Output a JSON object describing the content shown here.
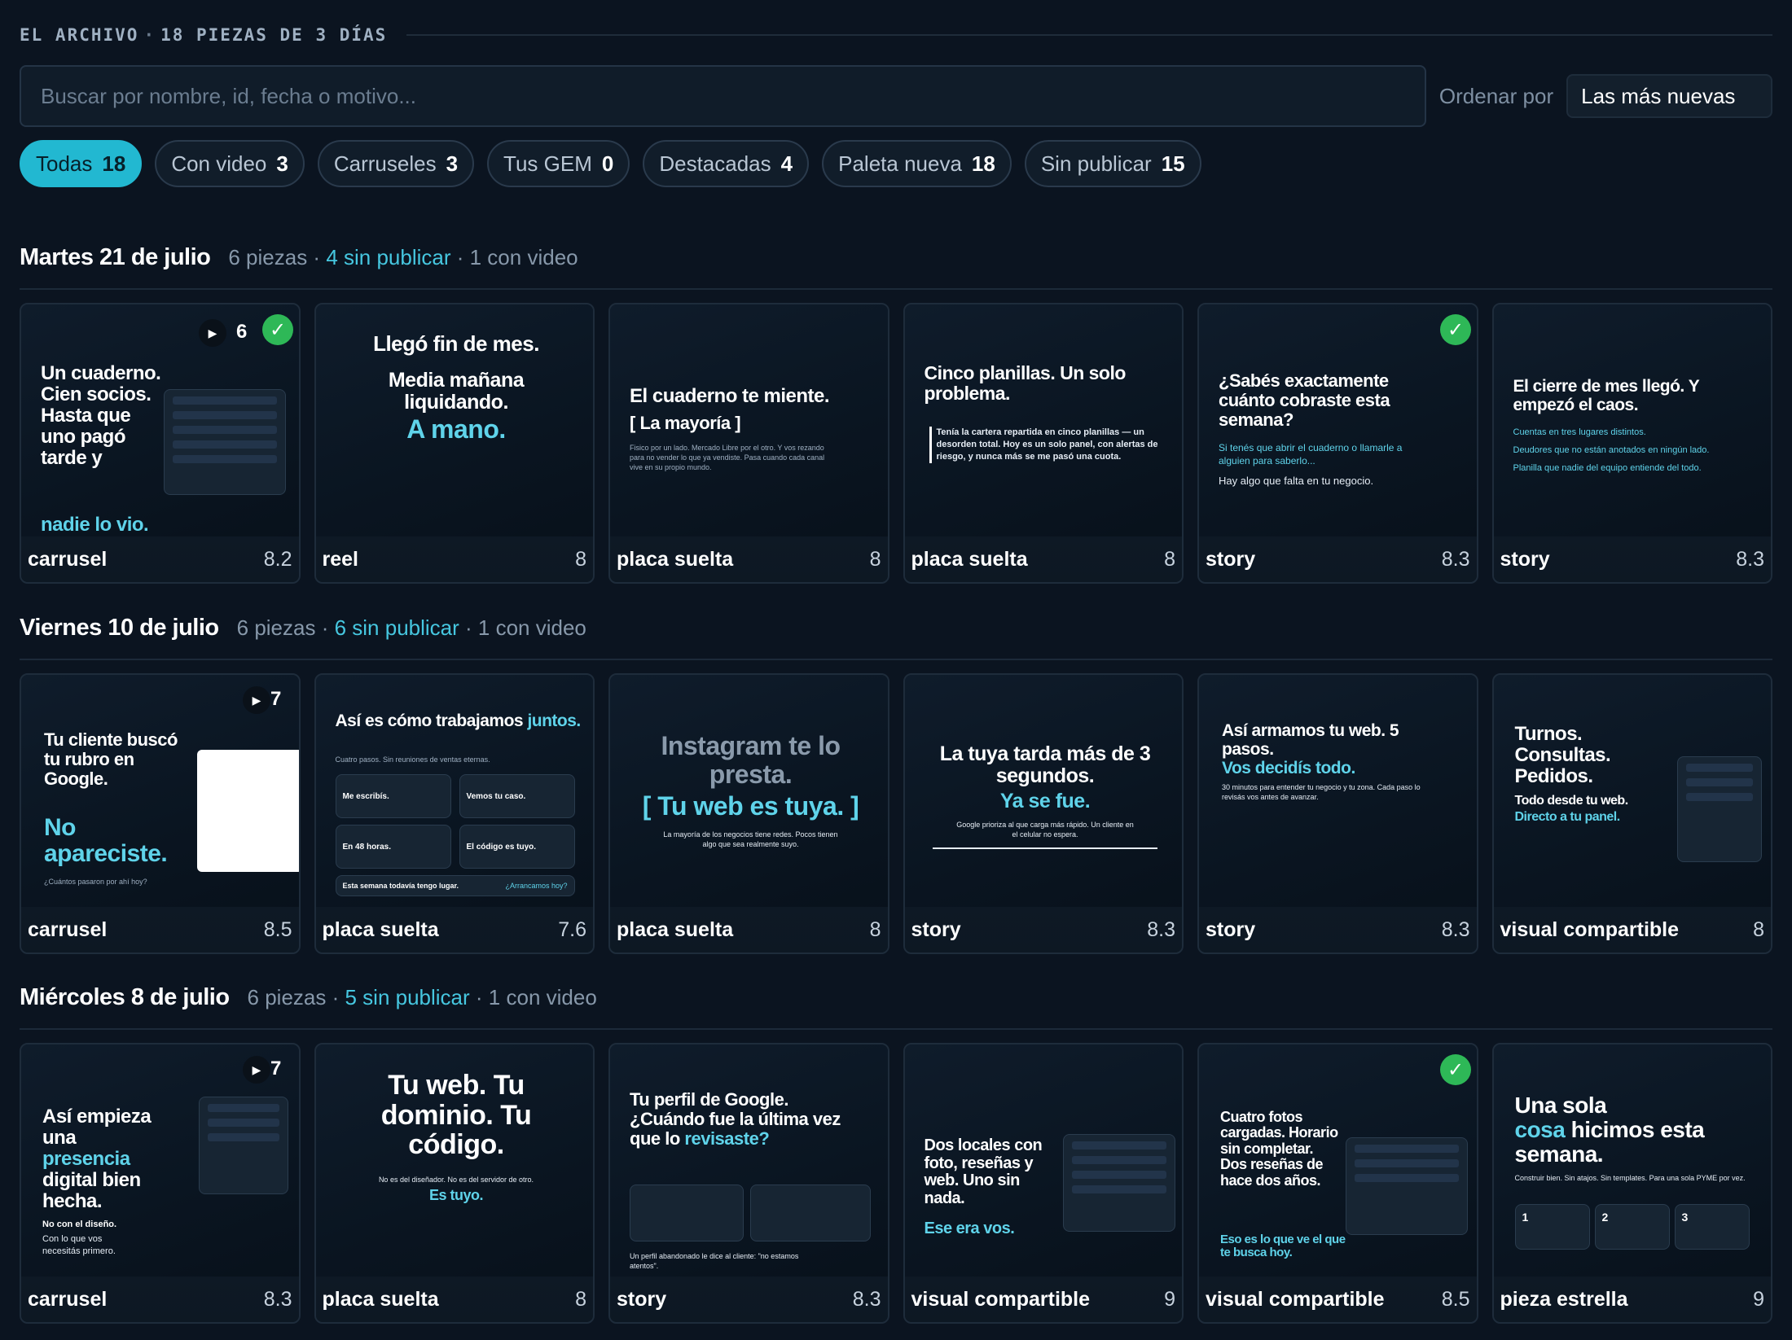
{
  "header": {
    "title": "EL ARCHIVO",
    "subtitle": "18 PIEZAS DE 3 DÍAS",
    "separator": "·"
  },
  "search": {
    "placeholder": "Buscar por nombre, id, fecha o motivo..."
  },
  "sort": {
    "label": "Ordenar por",
    "value": "Las más nuevas"
  },
  "filters": [
    {
      "label": "Todas",
      "count": "18",
      "active": true
    },
    {
      "label": "Con video",
      "count": "3"
    },
    {
      "label": "Carruseles",
      "count": "3"
    },
    {
      "label": "Tus GEM",
      "count": "0"
    },
    {
      "label": "Destacadas",
      "count": "4"
    },
    {
      "label": "Paleta nueva",
      "count": "18"
    },
    {
      "label": "Sin publicar",
      "count": "15"
    }
  ],
  "sections": [
    {
      "title": "Martes 21 de julio",
      "pieces": "6 piezas",
      "unpublished": "4 sin publicar",
      "video": "1 con video",
      "cards": [
        {
          "type": "carrusel",
          "score": "8.2",
          "play": "▶",
          "count": "6",
          "check": true,
          "headline": "Un cuaderno. Cien socios. Hasta que uno pagó tarde y",
          "accent": "nadie lo vio."
        },
        {
          "type": "reel",
          "score": "8",
          "headline": "Llegó fin de mes.",
          "line2": "Media mañana liquidando.",
          "accent": "A mano."
        },
        {
          "type": "placa suelta",
          "score": "8",
          "headline": "El cuaderno te miente.",
          "line2": "[ La mayoría ]",
          "small": "Fisico por un lado. Mercado Libre por el otro. Y vos rezando para no vender lo que ya vendiste. Pasa cuando cada canal vive en su propio mundo."
        },
        {
          "type": "placa suelta",
          "score": "8",
          "headline": "Cinco planillas. Un solo problema.",
          "small": "Tenía la cartera repartida en cinco planillas — un desorden total. Hoy es un solo panel, con alertas de riesgo, y nunca más se me pasó una cuota."
        },
        {
          "type": "story",
          "score": "8.3",
          "check": true,
          "headline": "¿Sabés exactamente cuánto cobraste esta semana?",
          "small": "Si tenés que abrir el cuaderno o llamarle a alguien para saberlo...",
          "line2": "Hay algo que falta en tu negocio."
        },
        {
          "type": "story",
          "score": "8.3",
          "headline": "El cierre de mes llegó. Y empezó el caos.",
          "small": "Cuentas en tres lugares distintos.",
          "line2": "Deudores que no están anotados en ningún lado.",
          "line3": "Planilla que nadie del equipo entiende del todo."
        }
      ]
    },
    {
      "title": "Viernes 10 de julio",
      "pieces": "6 piezas",
      "unpublished": "6 sin publicar",
      "video": "1 con video",
      "cards": [
        {
          "type": "carrusel",
          "score": "8.5",
          "play": "▶",
          "count": "7",
          "headline": "Tu cliente buscó tu rubro en Google.",
          "accent": "No apareciste.",
          "small": "¿Cuántos pasaron por ahí hoy?"
        },
        {
          "type": "placa suelta",
          "score": "7.6",
          "headline": "Así es cómo trabajamos",
          "accent": "juntos.",
          "small": "Cuatro pasos. Sin reuniones de ventas eternas.",
          "steps": [
            "Me escribís.",
            "Vemos tu caso.",
            "En 48 horas.",
            "El código es tuyo."
          ],
          "bar": "Esta semana todavía tengo lugar.",
          "bar_link": "¿Arrancamos hoy?"
        },
        {
          "type": "placa suelta",
          "score": "8",
          "headline": "Instagram te lo presta.",
          "accent": "[ Tu web es tuya. ]",
          "small": "La mayoría de los negocios tiene redes. Pocos tienen algo que sea realmente suyo."
        },
        {
          "type": "story",
          "score": "8.3",
          "headline": "La tuya tarda más de 3 segundos.",
          "accent": "Ya se fue.",
          "small": "Google prioriza al que carga más rápido. Un cliente en el celular no espera."
        },
        {
          "type": "story",
          "score": "8.3",
          "headline": "Así armamos tu web. 5 pasos.",
          "accent": "Vos decidís todo.",
          "small": "30 minutos para entender tu negocio y tu zona. Cada paso lo revisás vos antes de avanzar."
        },
        {
          "type": "visual compartible",
          "score": "8",
          "headline": "Turnos. Consultas. Pedidos.",
          "line2": "Todo desde tu web.",
          "accent": "Directo a tu panel."
        }
      ]
    },
    {
      "title": "Miércoles 8 de julio",
      "pieces": "6 piezas",
      "unpublished": "5 sin publicar",
      "video": "1 con video",
      "cards": [
        {
          "type": "carrusel",
          "score": "8.3",
          "play": "▶",
          "count": "7",
          "headline": "Así empieza una",
          "accent": "presencia",
          "line2": "digital bien hecha.",
          "small": "No con el diseño.",
          "line3": "Con lo que vos necesitás primero."
        },
        {
          "type": "placa suelta",
          "score": "8",
          "headline": "Tu web. Tu dominio. Tu código.",
          "small": "No es del diseñador. No es del servidor de otro.",
          "accent": "Es tuyo."
        },
        {
          "type": "story",
          "score": "8.3",
          "headline": "Tu perfil de Google. ¿Cuándo fue la última vez que lo",
          "accent": "revisaste?",
          "small": "Un perfil abandonado le dice al cliente: \"no estamos atentos\"."
        },
        {
          "type": "visual compartible",
          "score": "9",
          "headline": "Dos locales con foto, reseñas y web. Uno sin nada.",
          "accent": "Ese era vos."
        },
        {
          "type": "visual compartible",
          "score": "8.5",
          "check": true,
          "headline": "Cuatro fotos cargadas. Horario sin completar. Dos reseñas de hace dos años.",
          "accent": "Eso es lo que ve el que te busca hoy."
        },
        {
          "type": "pieza estrella",
          "score": "9",
          "headline": "Una sola",
          "accent": "cosa",
          "line2": "hicimos esta semana.",
          "small": "Construir bien. Sin atajos. Sin templates. Para una sola PYME por vez.",
          "steps": [
            "1",
            "2",
            "3"
          ]
        }
      ]
    }
  ],
  "colors": {
    "accent": "#22b8d1",
    "check": "#2eb857",
    "background": "#0b1420"
  }
}
